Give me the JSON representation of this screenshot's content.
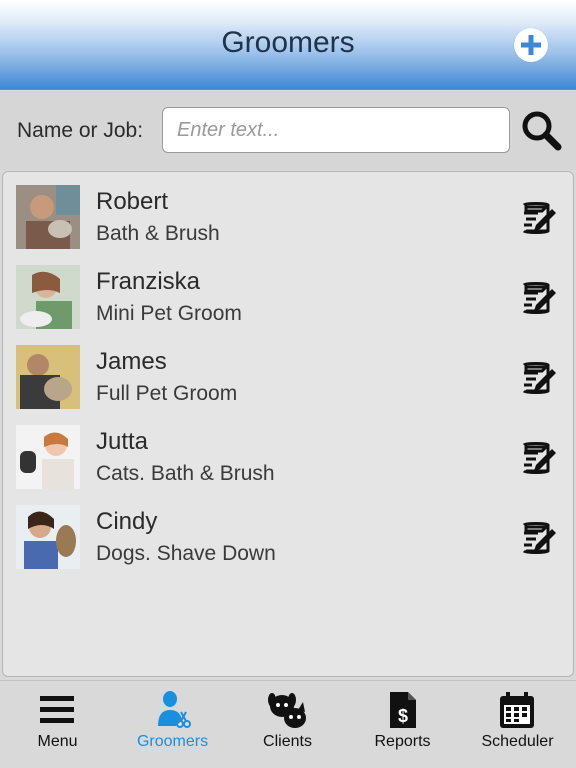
{
  "header": {
    "title": "Groomers",
    "add_icon": "plus-circle-icon"
  },
  "search": {
    "label": "Name or Job:",
    "placeholder": "Enter text...",
    "value": "",
    "icon": "magnifier-icon"
  },
  "groomers": [
    {
      "name": "Robert",
      "job": "Bath & Brush"
    },
    {
      "name": "Franziska",
      "job": "Mini Pet Groom"
    },
    {
      "name": "James",
      "job": "Full Pet Groom"
    },
    {
      "name": "Jutta",
      "job": "Cats. Bath & Brush"
    },
    {
      "name": "Cindy",
      "job": "Dogs. Shave Down"
    }
  ],
  "tabs": [
    {
      "label": "Menu",
      "icon": "hamburger-icon"
    },
    {
      "label": "Groomers",
      "icon": "groomer-scissors-icon",
      "active": true
    },
    {
      "label": "Clients",
      "icon": "pets-icon"
    },
    {
      "label": "Reports",
      "icon": "dollar-document-icon"
    },
    {
      "label": "Scheduler",
      "icon": "calendar-icon"
    }
  ],
  "colors": {
    "header_blue": "#3f87d6",
    "active_tab": "#1a8fe0",
    "background": "#d9d9d9"
  }
}
